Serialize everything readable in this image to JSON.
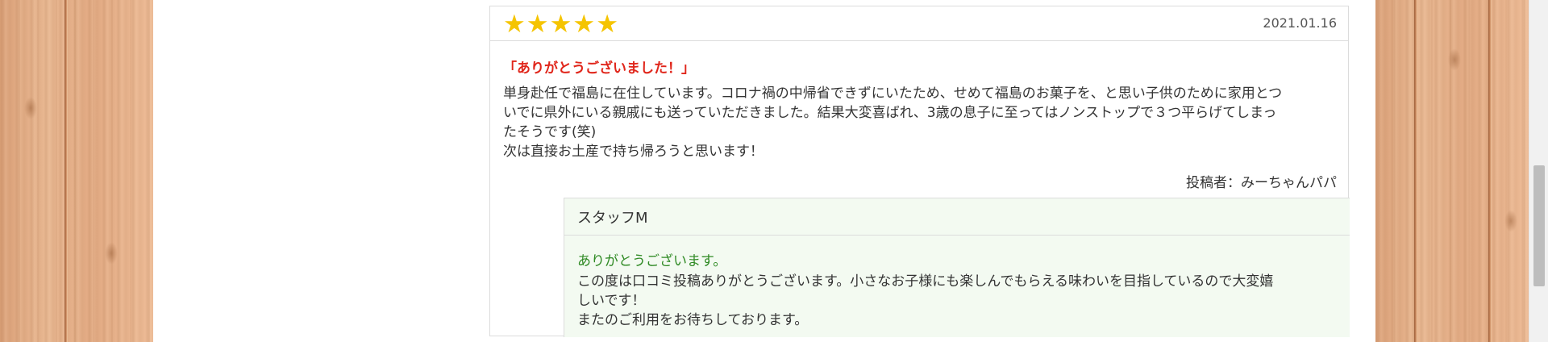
{
  "review": {
    "rating": 5,
    "stars": [
      "★",
      "★",
      "★",
      "★",
      "★"
    ],
    "date": "2021.01.16",
    "title": "「ありがとうございました！」",
    "body_lines": [
      "単身赴任で福島に在住しています。コロナ禍の中帰省できずにいたため、せめて福島のお菓子を、と思い子供のために家用とつ",
      "いでに県外にいる親戚にも送っていただきました。結果大変喜ばれ、3歳の息子に至ってはノンストップで３つ平らげてしまっ",
      "たそうです(笑)",
      "次は直接お土産で持ち帰ろうと思います！"
    ],
    "author_prefix": "投稿者：",
    "author_name": "みーちゃんパパ"
  },
  "reply": {
    "staff_name": "スタッフM",
    "title": "ありがとうございます。",
    "body_lines": [
      "この度は口コミ投稿ありがとうございます。小さなお子様にも楽しんでもらえる味わいを目指しているので大変嬉",
      "しいです！",
      "またのご利用をお待ちしております。"
    ]
  },
  "colors": {
    "star": "#f5c400",
    "review_title": "#e0261b",
    "reply_title": "#2f8a24",
    "reply_background": "#f3faf1",
    "border": "#dcdcdc"
  }
}
